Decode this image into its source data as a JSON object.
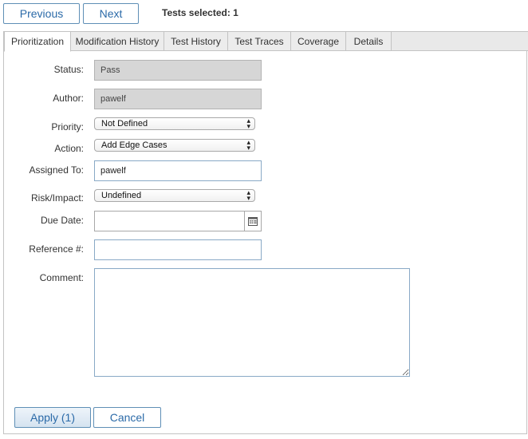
{
  "nav": {
    "previous_label": "Previous",
    "next_label": "Next"
  },
  "tests_selected": "Tests selected: 1",
  "tabs": [
    {
      "label": "Prioritization",
      "active": true
    },
    {
      "label": "Modification History"
    },
    {
      "label": "Test History"
    },
    {
      "label": "Test Traces"
    },
    {
      "label": "Coverage"
    },
    {
      "label": "Details"
    }
  ],
  "form": {
    "status": {
      "label": "Status:",
      "value": "Pass"
    },
    "author": {
      "label": "Author:",
      "value": "pawelf"
    },
    "priority": {
      "label": "Priority:",
      "value": "Not Defined"
    },
    "action": {
      "label": "Action:",
      "value": "Add Edge Cases"
    },
    "assigned_to": {
      "label": "Assigned To:",
      "value": "pawelf"
    },
    "risk_impact": {
      "label": "Risk/Impact:",
      "value": "Undefined"
    },
    "due_date": {
      "label": "Due Date:",
      "value": ""
    },
    "reference": {
      "label": "Reference #:",
      "value": ""
    },
    "comment": {
      "label": "Comment:",
      "value": ""
    }
  },
  "actions": {
    "apply_label": "Apply (1)",
    "cancel_label": "Cancel"
  },
  "icons": {
    "calendar": "calendar-icon",
    "select_arrows": "updown-arrows-icon"
  },
  "colors": {
    "button_border": "#5f8fb6",
    "button_text": "#2b6aa8",
    "readonly_bg": "#d6d6d6"
  }
}
